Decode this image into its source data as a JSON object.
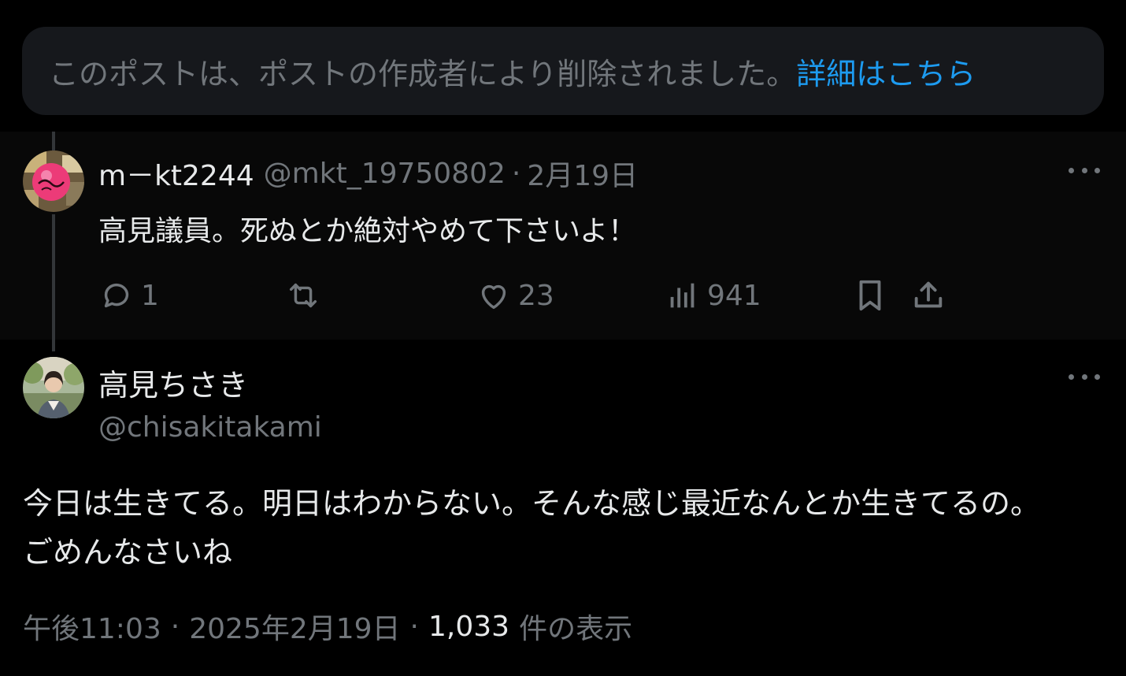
{
  "notice": {
    "text": "このポストは、ポストの作成者により削除されました。",
    "link": "詳細はこちら"
  },
  "reply": {
    "name": "m－kt2244",
    "handle": "@mkt_19750802",
    "separator": "·",
    "date": "2月19日",
    "text": "高見議員。死ぬとか絶対やめて下さいよ！",
    "actions": {
      "replies": "1",
      "reposts": "",
      "likes": "23",
      "views": "941"
    }
  },
  "post": {
    "name": "高見ちさき",
    "handle": "@chisakitakami",
    "text_lines": [
      "今日は生きてる。明日はわからない。そんな感じ最近なんとか生きてるの。",
      "ごめんなさいね"
    ],
    "time": "午後11:03",
    "separator": "·",
    "date": "2025年2月19日",
    "views_count": "1,033",
    "views_label": "件の表示"
  },
  "colors": {
    "background": "#000000",
    "notice_bg": "#16181c",
    "link": "#1d9bf0",
    "muted": "#71767b",
    "text": "#e7e9ea"
  }
}
